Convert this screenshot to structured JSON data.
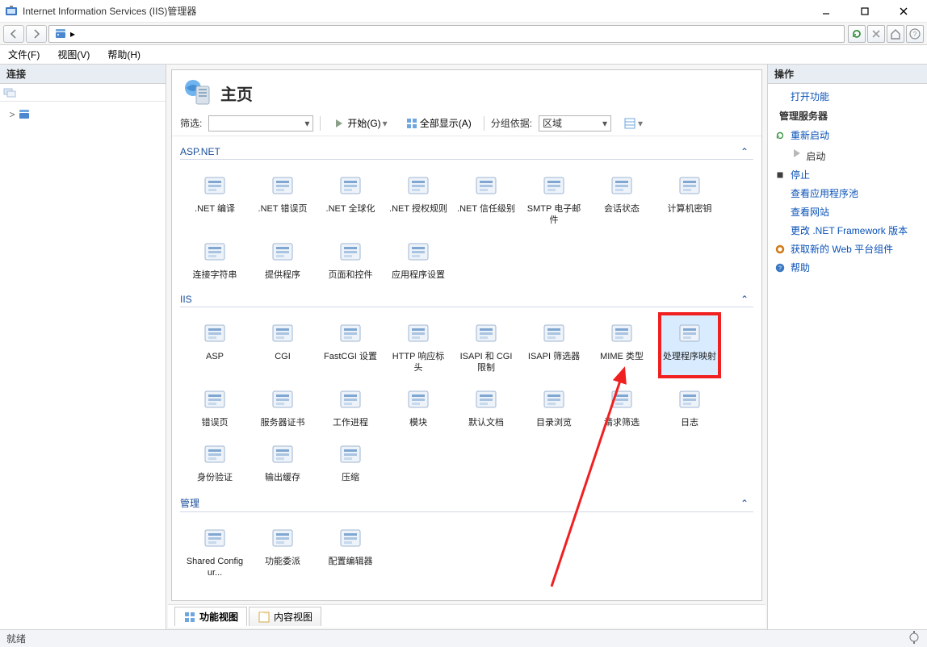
{
  "window": {
    "title": "Internet Information Services (IIS)管理器",
    "min": "—",
    "max": "☐",
    "close": "✕"
  },
  "address": {
    "text": "▸"
  },
  "menu": {
    "file": "文件(F)",
    "view": "视图(V)",
    "help": "帮助(H)"
  },
  "left": {
    "header": "连接",
    "rootExpand": ">"
  },
  "center": {
    "title_suffix": "主页",
    "filter_label": "筛选:",
    "start_label": "开始(G)",
    "showall_label": "全部显示(A)",
    "groupby_label": "分组依据:",
    "groupby_value": "区域",
    "groups": {
      "aspnet": {
        "title": "ASP.NET",
        "items": [
          {
            "label": ".NET 编译"
          },
          {
            "label": ".NET 错误页"
          },
          {
            "label": ".NET 全球化"
          },
          {
            "label": ".NET 授权规则"
          },
          {
            "label": ".NET 信任级别"
          },
          {
            "label": "SMTP 电子邮件"
          },
          {
            "label": "会话状态"
          },
          {
            "label": "计算机密钥"
          },
          {
            "label": "连接字符串"
          },
          {
            "label": "提供程序"
          },
          {
            "label": "页面和控件"
          },
          {
            "label": "应用程序设置"
          }
        ]
      },
      "iis": {
        "title": "IIS",
        "items": [
          {
            "label": "ASP"
          },
          {
            "label": "CGI"
          },
          {
            "label": "FastCGI 设置"
          },
          {
            "label": "HTTP 响应标头"
          },
          {
            "label": "ISAPI 和 CGI 限制"
          },
          {
            "label": "ISAPI 筛选器"
          },
          {
            "label": "MIME 类型"
          },
          {
            "label": "处理程序映射",
            "highlight": true
          },
          {
            "label": "错误页"
          },
          {
            "label": "服务器证书"
          },
          {
            "label": "工作进程"
          },
          {
            "label": "模块"
          },
          {
            "label": "默认文档"
          },
          {
            "label": "目录浏览"
          },
          {
            "label": "请求筛选"
          },
          {
            "label": "日志"
          },
          {
            "label": "身份验证"
          },
          {
            "label": "输出缓存"
          },
          {
            "label": "压缩"
          }
        ]
      },
      "mgmt": {
        "title": "管理",
        "items": [
          {
            "label": "Shared Configur..."
          },
          {
            "label": "功能委派"
          },
          {
            "label": "配置编辑器"
          }
        ]
      }
    },
    "viewtab_feature": "功能视图",
    "viewtab_content": "内容视图"
  },
  "right": {
    "header": "操作",
    "open_feature": "打开功能",
    "manage_server": "管理服务器",
    "restart": "重新启动",
    "start": "启动",
    "stop": "停止",
    "view_apppools": "查看应用程序池",
    "view_sites": "查看网站",
    "change_fw": "更改 .NET Framework 版本",
    "get_webpi": "获取新的 Web 平台组件",
    "help": "帮助"
  },
  "status": {
    "ready": "就绪"
  }
}
